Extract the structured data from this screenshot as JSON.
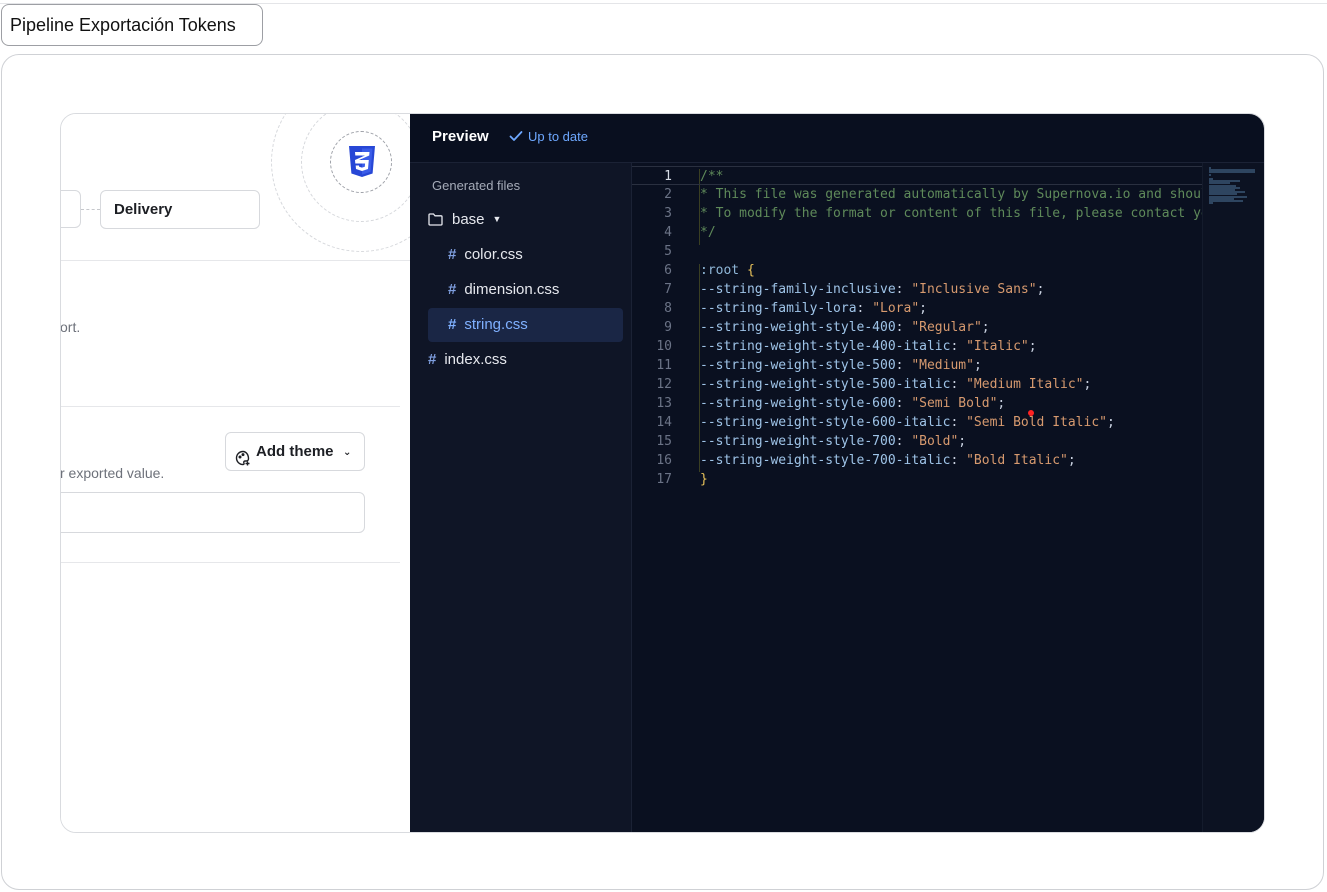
{
  "page": {
    "title": "Pipeline Exportación Tokens"
  },
  "pipeline": {
    "node_label": "Delivery",
    "description_fragment": "ort.",
    "theme_hint_fragment": "r exported value.",
    "add_theme_label": "Add theme",
    "badge_icon": "css3-icon"
  },
  "preview": {
    "title": "Preview",
    "status": "Up to date",
    "files_label": "Generated files",
    "folder": {
      "name": "base",
      "icon": "folder-icon"
    },
    "files": [
      {
        "name": "color.css"
      },
      {
        "name": "dimension.css"
      },
      {
        "name": "string.css",
        "selected": true
      },
      {
        "name": "index.css"
      }
    ]
  },
  "code": {
    "lines": [
      {
        "n": "1",
        "t": "/**"
      },
      {
        "n": "2",
        "t": " * This file was generated automatically by Supernova.io and shoul"
      },
      {
        "n": "3",
        "t": " * To modify the format or content of this file, please contact yo"
      },
      {
        "n": "4",
        "t": " */"
      },
      {
        "n": "5",
        "t": ""
      },
      {
        "n": "6",
        "sel": ":root",
        "brace": " {"
      },
      {
        "n": "7",
        "prop": "--string-family-inclusive",
        "val": "\"Inclusive Sans\""
      },
      {
        "n": "8",
        "prop": "--string-family-lora",
        "val": "\"Lora\""
      },
      {
        "n": "9",
        "prop": "--string-weight-style-400",
        "val": "\"Regular\""
      },
      {
        "n": "10",
        "prop": "--string-weight-style-400-italic",
        "val": "\"Italic\""
      },
      {
        "n": "11",
        "prop": "--string-weight-style-500",
        "val": "\"Medium\""
      },
      {
        "n": "12",
        "prop": "--string-weight-style-500-italic",
        "val": "\"Medium Italic\""
      },
      {
        "n": "13",
        "prop": "--string-weight-style-600",
        "val": "\"Semi Bold\""
      },
      {
        "n": "14",
        "prop": "--string-weight-style-600-italic",
        "val": "\"Semi Bold Italic\""
      },
      {
        "n": "15",
        "prop": "--string-weight-style-700",
        "val": "\"Bold\""
      },
      {
        "n": "16",
        "prop": "--string-weight-style-700-italic",
        "val": "\"Bold Italic\""
      },
      {
        "n": "17",
        "brace": "}"
      }
    ]
  },
  "colors": {
    "dark_bg": "#090f1f",
    "accent_blue": "#6ea8ff",
    "css_badge_blue": "#2747d6",
    "code_string": "#d79a6f",
    "code_comment": "#5f8a5a",
    "code_brace": "#e8c25a"
  }
}
